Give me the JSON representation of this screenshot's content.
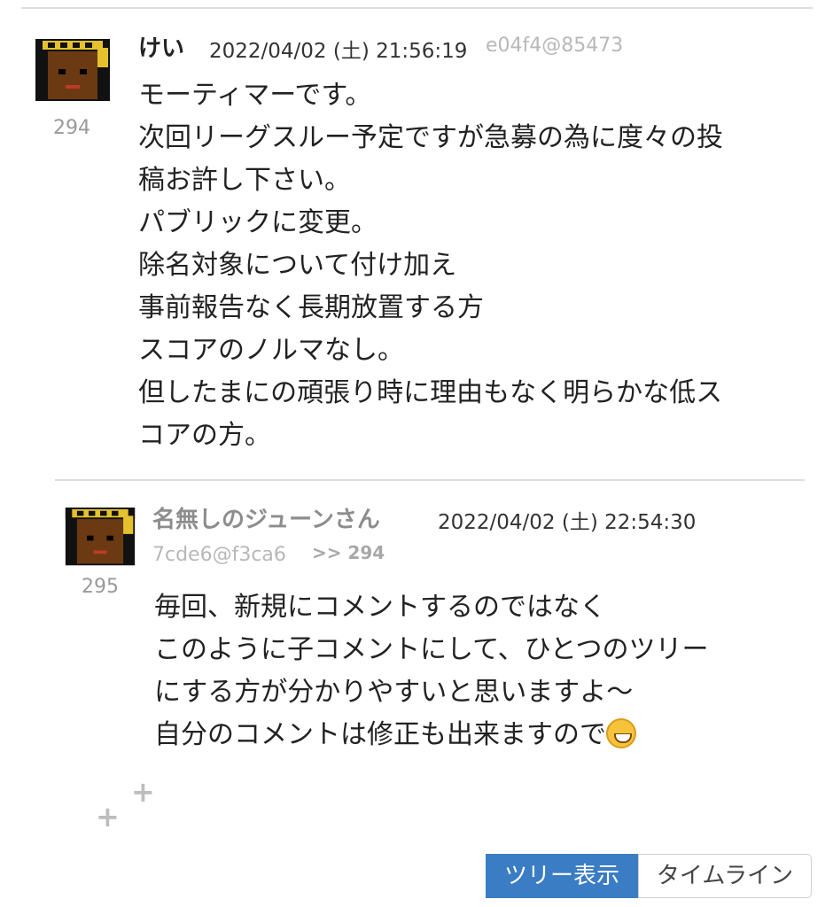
{
  "comments": [
    {
      "number": "294",
      "author": "けい",
      "datetime": "2022/04/02 (土) 21:56:19",
      "user_id": "e04f4@85473",
      "body_lines": [
        "モーティマーです。",
        "次回リーグスルー予定ですが急募の為に度々の投",
        "稿お許し下さい。",
        "パブリックに変更。",
        "除名対象について付け加え",
        "事前報告なく長期放置する方",
        "スコアのノルマなし。",
        "但したまにの頑張り時に理由もなく明らかな低ス",
        "コアの方。"
      ]
    },
    {
      "number": "295",
      "author": "名無しのジューンさん",
      "datetime": "2022/04/02 (土) 22:54:30",
      "user_id": "7cde6@f3ca6",
      "reply_to": ">> 294",
      "body_lines": [
        "毎回、新規にコメントするのではなく",
        "このように子コメントにして、ひとつのツリー",
        "にする方が分かりやすいと思いますよ〜",
        "自分のコメントは修正も出来ますので"
      ],
      "trailing_emoji": "grinning-face-icon"
    }
  ],
  "decor": {
    "plus_glyph": "+"
  },
  "view_toggle": {
    "tree_label": "ツリー表示",
    "timeline_label": "タイムライン",
    "active": "tree"
  },
  "colors": {
    "active_button": "#3b7dc4",
    "muted_text": "#9a9a9a",
    "emoji": "#f6c33a"
  }
}
